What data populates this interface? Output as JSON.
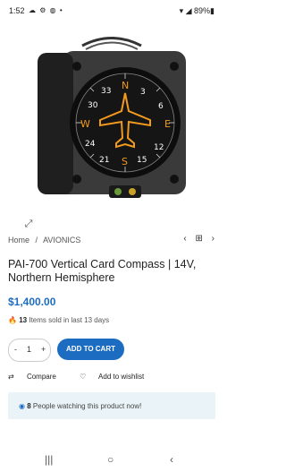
{
  "status_bar": {
    "time": "1:52",
    "left_icons": "☁ ⚙ ◍ •",
    "right": "▾ ◢ 89%▮"
  },
  "breadcrumb": {
    "home": "Home",
    "separator": "/",
    "category": "AVIONICS"
  },
  "crumb_nav": {
    "prev": "‹",
    "grid": "⊞",
    "next": "›"
  },
  "product": {
    "title": "PAI-700 Vertical Card Compass | 14V, Northern Hemisphere",
    "price": "$1,400.00",
    "sold_count": "13",
    "sold_text": "Items sold in last 13 days"
  },
  "quantity": {
    "minus": "-",
    "value": "1",
    "plus": "+"
  },
  "add_to_cart_label": "ADD TO CART",
  "actions": {
    "compare": "Compare",
    "wishlist": "Add to wishlist"
  },
  "watching": {
    "count": "8",
    "text": "People watching this product now!"
  },
  "compass_card": {
    "N": "N",
    "E": "E",
    "S": "S",
    "W": "W",
    "n3": "3",
    "n6": "6",
    "n12": "12",
    "n15": "15",
    "n21": "21",
    "n24": "24",
    "n30": "30",
    "n33": "33"
  },
  "nav_bar": {
    "recents": "|||",
    "home": "○",
    "back": "‹"
  },
  "colors": {
    "accent": "#1c6cc1",
    "watch_bg": "#eaf4f8",
    "compass_orange": "#f29a1e"
  }
}
